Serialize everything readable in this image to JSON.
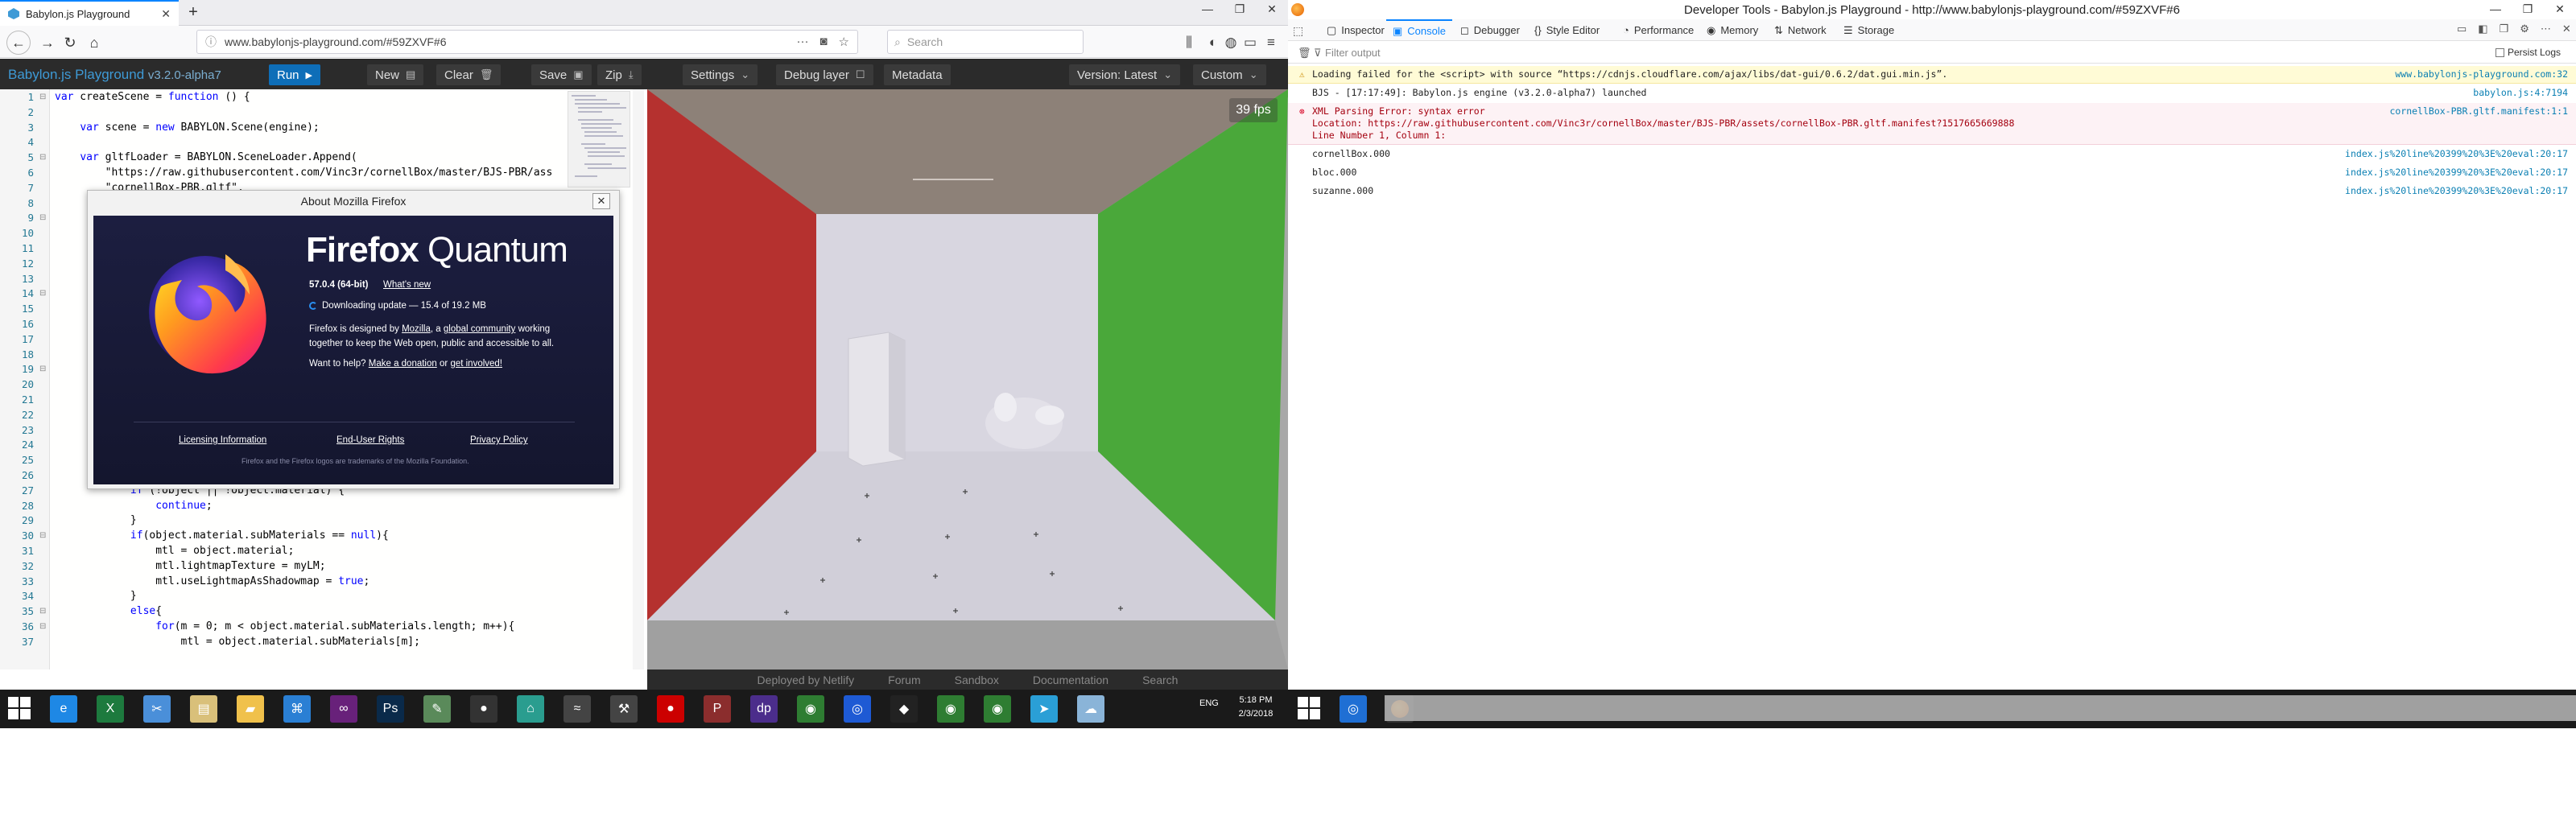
{
  "browser": {
    "tab_title": "Babylon.js Playground",
    "url": "www.babylonjs-playground.com/#59ZXVF#6",
    "search_placeholder": "Search"
  },
  "playground": {
    "title": "Babylon.js Playground",
    "version": "v3.2.0-alpha7",
    "buttons": {
      "run": "Run",
      "new": "New",
      "clear": "Clear",
      "save": "Save",
      "zip": "Zip",
      "settings": "Settings",
      "debug": "Debug layer",
      "metadata": "Metadata",
      "version_select": "Version: Latest",
      "custom": "Custom"
    },
    "fps": "39 fps",
    "footer_links": [
      "Deployed by Netlify",
      "Forum",
      "Sandbox",
      "Documentation",
      "Search"
    ]
  },
  "code": {
    "line_numbers": [
      "1",
      "2",
      "3",
      "4",
      "5",
      "6",
      "7",
      "8",
      "9",
      "10",
      "11",
      "12",
      "13",
      "14",
      "15",
      "16",
      "17",
      "18",
      "19",
      "20",
      "21",
      "22",
      "23",
      "24",
      "25",
      "26",
      "27",
      "28",
      "29",
      "30",
      "31",
      "32",
      "33",
      "34",
      "35",
      "36",
      "37"
    ],
    "lines": [
      "var createScene = function () {",
      "",
      "    var scene = new BABYLON.Scene(engine);",
      "",
      "    var gltfLoader = BABYLON.SceneLoader.Append(",
      "        \"https://raw.githubusercontent.com/Vinc3r/cornellBox/master/BJS-PBR/ass",
      "        \"cornellBox-PBR.gltf\",",
      "",
      "",
      "",
      "",
      "",
      "",
      "",
      "",
      "",
      "",
      "",
      "",
      "",
      "",
      "",
      "",
      "",
      "",
      "",
      "            if (!object || !object.material) {",
      "                continue;",
      "            }",
      "            if(object.material.subMaterials == null){",
      "                mtl = object.material;",
      "                mtl.lightmapTexture = myLM;",
      "                mtl.useLightmapAsShadowmap = true;",
      "            }",
      "            else{",
      "                for(m = 0; m < object.material.subMaterials.length; m++){",
      "                    mtl = object.material.subMaterials[m];"
    ]
  },
  "about": {
    "title": "About Mozilla Firefox",
    "brand": "Firefox",
    "brand_suffix": "Quantum",
    "version": "57.0.4 (64-bit)",
    "whats_new": "What's new",
    "update_status": "Downloading update — 15.4 of 19.2 MB",
    "desc_part1": "Firefox is designed by",
    "desc_mozilla": "Mozilla",
    "desc_part2": ", a",
    "desc_community": "global community",
    "desc_part3": "working together to keep the Web open, public and accessible to all.",
    "help_prefix": "Want to help?",
    "help_donate": "Make a donation",
    "help_or": "or",
    "help_involved": "get involved!",
    "footer_links": [
      "Licensing Information",
      "End-User Rights",
      "Privacy Policy"
    ],
    "trademark": "Firefox and the Firefox logos are trademarks of the Mozilla Foundation."
  },
  "devtools": {
    "window_title": "Developer Tools - Babylon.js Playground - http://www.babylonjs-playground.com/#59ZXVF#6",
    "tabs": [
      "Inspector",
      "Console",
      "Debugger",
      "Style Editor",
      "Performance",
      "Memory",
      "Network",
      "Storage"
    ],
    "filter_placeholder": "Filter output",
    "persist_logs": "Persist Logs",
    "messages": [
      {
        "type": "warn",
        "text": "Loading failed for the <script> with source “https://cdnjs.cloudflare.com/ajax/libs/dat-gui/0.6.2/dat.gui.min.js”.",
        "source": "www.babylonjs-playground.com:32"
      },
      {
        "type": "log",
        "text": "BJS - [17:17:49]: Babylon.js engine (v3.2.0-alpha7) launched",
        "source": "babylon.js:4:7194"
      },
      {
        "type": "err",
        "text": "XML Parsing Error: syntax error\nLocation: https://raw.githubusercontent.com/Vinc3r/cornellBox/master/BJS-PBR/assets/cornellBox-PBR.gltf.manifest?1517665669888\nLine Number 1, Column 1:",
        "source": "cornellBox-PBR.gltf.manifest:1:1"
      },
      {
        "type": "log",
        "text": "cornellBox.000",
        "source": "index.js%20line%20399%20%3E%20eval:20:17"
      },
      {
        "type": "log",
        "text": "bloc.000",
        "source": "index.js%20line%20399%20%3E%20eval:20:17"
      },
      {
        "type": "log",
        "text": "suzanne.000",
        "source": "index.js%20line%20399%20%3E%20eval:20:17"
      }
    ]
  },
  "taskbar": {
    "lang": "ENG",
    "time": "5:18 PM",
    "date": "2/3/2018"
  },
  "colors": {
    "run_button": "#0e6eb8",
    "brand_blue": "#3e9ad6",
    "wall_red": "#b5312f",
    "wall_green": "#4aa83a",
    "devtools_accent": "#0a84ff"
  }
}
